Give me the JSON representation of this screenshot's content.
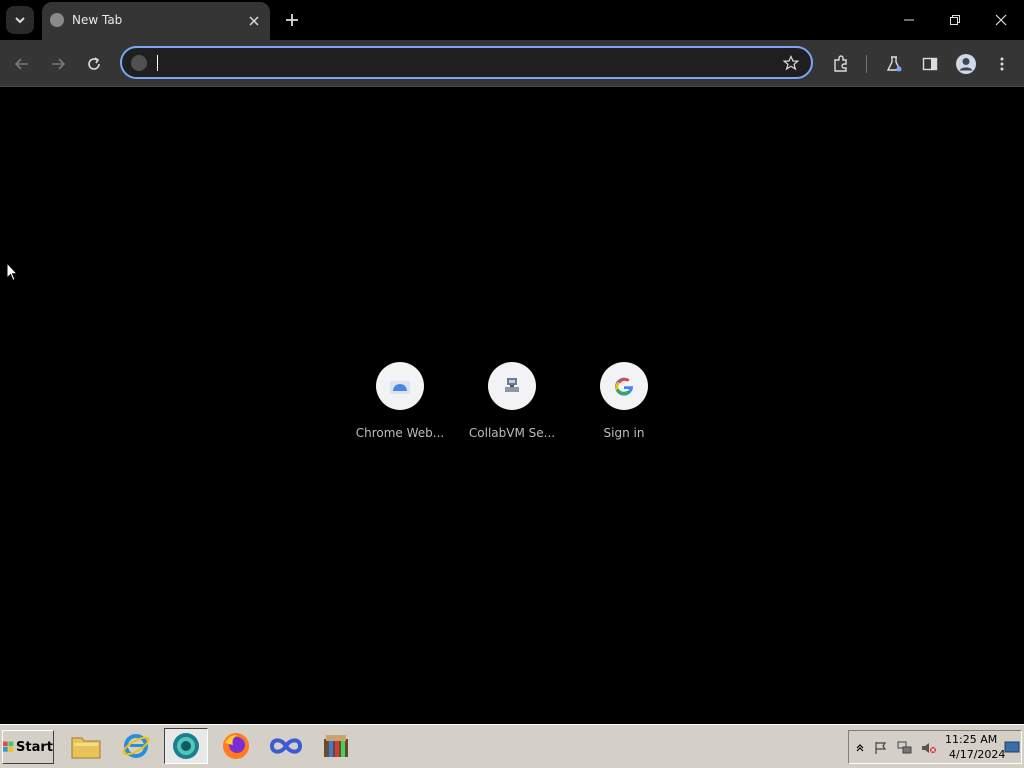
{
  "browser": {
    "tabs": [
      {
        "title": "New Tab"
      }
    ],
    "address_bar": {
      "value": "",
      "placeholder": ""
    },
    "accent_color": "#7aa7f7"
  },
  "shortcuts": [
    {
      "label": "Chrome Web...",
      "icon": "chrome-web-store-icon"
    },
    {
      "label": "CollabVM Se...",
      "icon": "collabvm-icon"
    },
    {
      "label": "Sign in",
      "icon": "google-g-icon"
    }
  ],
  "taskbar": {
    "start_label": "Start",
    "apps": [
      {
        "name": "file-explorer",
        "icon": "folder-icon",
        "active": false
      },
      {
        "name": "internet-explorer",
        "icon": "ie-icon",
        "active": false
      },
      {
        "name": "chrome-dev",
        "icon": "chrome-icon",
        "active": true
      },
      {
        "name": "firefox",
        "icon": "firefox-icon",
        "active": false
      },
      {
        "name": "infinity-app",
        "icon": "infinity-icon",
        "active": false
      },
      {
        "name": "archive-app",
        "icon": "archive-icon",
        "active": false
      }
    ],
    "clock": {
      "time": "11:25 AM",
      "date": "4/17/2024"
    }
  }
}
